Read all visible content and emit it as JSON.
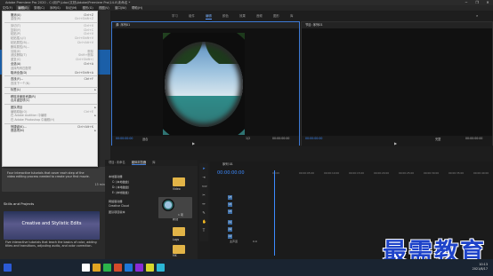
{
  "window": {
    "title": "Adobe Premiere Pro 2020 - C:\\用户\\Ldoc\\文档\\Adobe\\Premiere Pro\\14.0\\未命名 *",
    "controls": [
      "─",
      "❐",
      "✕"
    ]
  },
  "menubar": {
    "items": [
      "文件(F)",
      "编辑(E)",
      "剪辑(C)",
      "序列(S)",
      "标记(M)",
      "图形(G)",
      "视图(V)",
      "窗口(W)",
      "帮助(H)"
    ],
    "active_index": 1
  },
  "workspace_tabs": [
    "学习",
    "组件",
    "编辑",
    "颜色",
    "效果",
    "音频",
    "图形",
    "库"
  ],
  "workspace_active": 2,
  "edit_menu": {
    "items": [
      {
        "label": "撤消(U)",
        "shortcut": "Ctrl+Z",
        "enabled": true
      },
      {
        "label": "重做(R)",
        "shortcut": "Ctrl+Shift+Z",
        "enabled": false
      },
      {
        "sep": true
      },
      {
        "label": "剪切(T)",
        "shortcut": "Ctrl+X",
        "enabled": false
      },
      {
        "label": "复制(Y)",
        "shortcut": "Ctrl+C",
        "enabled": false
      },
      {
        "label": "粘贴(P)",
        "shortcut": "Ctrl+V",
        "enabled": false
      },
      {
        "label": "粘贴插入(I)",
        "shortcut": "Ctrl+Shift+V",
        "enabled": false
      },
      {
        "label": "粘贴属性(B)...",
        "shortcut": "Ctrl+Alt+V",
        "enabled": false
      },
      {
        "label": "删除属性(R)...",
        "shortcut": "",
        "enabled": false
      },
      {
        "label": "清除(E)",
        "shortcut": "删除",
        "enabled": false
      },
      {
        "label": "波纹删除(T)",
        "shortcut": "Shift+删除",
        "enabled": false
      },
      {
        "label": "重复(C)",
        "shortcut": "Ctrl+Shift+/",
        "enabled": false
      },
      {
        "label": "全选(A)",
        "shortcut": "Ctrl+A",
        "enabled": true
      },
      {
        "label": "选择所有匹配项",
        "shortcut": "",
        "enabled": false
      },
      {
        "label": "取消全选(D)",
        "shortcut": "Ctrl+Shift+A",
        "enabled": true
      },
      {
        "sep": true
      },
      {
        "label": "查找(F)...",
        "shortcut": "Ctrl+F",
        "enabled": true
      },
      {
        "label": "查找下一个(N)",
        "shortcut": "",
        "enabled": false
      },
      {
        "sep": true
      },
      {
        "label": "标签(L)",
        "shortcut": "",
        "enabled": true,
        "submenu": true
      },
      {
        "sep": true
      },
      {
        "label": "移除未使用资源(R)",
        "shortcut": "",
        "enabled": true
      },
      {
        "label": "合并重复项(C)",
        "shortcut": "",
        "enabled": true
      },
      {
        "sep": true
      },
      {
        "label": "团队项目",
        "shortcut": "",
        "enabled": true,
        "submenu": true
      },
      {
        "label": "编辑原始(O)",
        "shortcut": "Ctrl+E",
        "enabled": false
      },
      {
        "label": "在 Adobe Audition 中编辑",
        "shortcut": "",
        "enabled": false,
        "submenu": true
      },
      {
        "label": "在 Adobe Photoshop 中编辑(H)",
        "shortcut": "",
        "enabled": false
      },
      {
        "sep": true
      },
      {
        "label": "快捷键(K)...",
        "shortcut": "Ctrl+Alt+K",
        "enabled": true
      },
      {
        "label": "首选项(N)",
        "shortcut": "",
        "enabled": true,
        "submenu": true
      }
    ]
  },
  "learn_panel": {
    "heading_fragments": [
      "Learn",
      "Com",
      "The",
      "Skills and Projects"
    ],
    "card1": {
      "desc": "Four interactive tutorials that cover each step of the video editing process needed to create your first movie.",
      "duration": "15 min"
    },
    "card2": {
      "title": "Creative and Stylistic Edits",
      "desc": "Five interactive tutorials that teach the basics of color, adding titles and transitions, adjusting audio, and color correction."
    }
  },
  "source_monitor": {
    "title": "源: 序列01",
    "timecode_left": "00:00:00:00",
    "fit": "适合",
    "ratio": "1/2",
    "timecode_right": "00:00:00:00"
  },
  "program_monitor": {
    "title": "节目: 序列01",
    "timecode_left": "00:00:00:00",
    "fit": "完整",
    "timecode_right": "00:00:00:00"
  },
  "project_panel": {
    "tabs": [
      "项目: 未命名",
      "媒体浏览器",
      "库"
    ],
    "tree": [
      "本地驱动器",
      "C: (本地磁盘)",
      "D: (本地磁盘)",
      "E: (本地磁盘)",
      "网络驱动器",
      "Creative Cloud",
      "团队项目版本"
    ],
    "thumbs": [
      "Video",
      "新建",
      "Logs",
      "MK"
    ],
    "count": "1 项"
  },
  "timeline": {
    "title": "序列 01",
    "timecode": "00:00:00:00",
    "ruler": [
      "00:00",
      "00:00:05:00",
      "00:00:10:00",
      "00:00:15:00",
      "00:00:20:00",
      "00:00:25:00",
      "00:00:30:00",
      "00:00:35:00",
      "00:00:40:00"
    ],
    "tracks": [
      "V3",
      "V2",
      "V1",
      "A1",
      "A2",
      "A3"
    ],
    "master": "主声道",
    "master_value": "0.0"
  },
  "watermark": "最需教育",
  "taskbar": {
    "time": "10:13",
    "date": "2021/8/17",
    "colors": [
      "#2b5ad6",
      "#ffffff",
      "#e0a522",
      "#2bb34a",
      "#d44a2a",
      "#1e77d8",
      "#8a2bd6",
      "#d6d62b",
      "#2bb6d6"
    ]
  },
  "accents": {
    "primary": "#3d8bff",
    "menu_bg": "#efefef",
    "banner": "#1b5fa8",
    "watermark": "#1e43c9"
  }
}
